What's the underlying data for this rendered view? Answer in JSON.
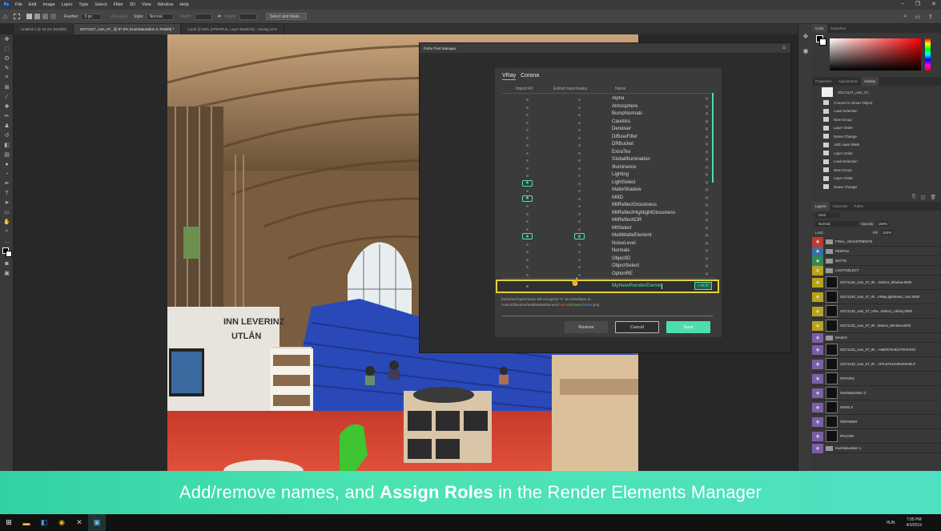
{
  "app": {
    "menu": [
      "File",
      "Edit",
      "Image",
      "Layer",
      "Type",
      "Select",
      "Filter",
      "3D",
      "View",
      "Window",
      "Help"
    ],
    "options": {
      "feather_label": "Feather:",
      "feather_value": "0 px",
      "anti_alias": "Anti-alias",
      "style_label": "Style:",
      "style_value": "Normal",
      "width_label": "Width:",
      "height_label": "Height:",
      "select_mask": "Select and Mask..."
    },
    "doc_tabs": [
      "Untitled-1 @ 34.2% (RGB/8)",
      "20171127_cam_07_ @ 57.5% (Hue/Saturation 3, RGB/8) *",
      "s.psb @ 50% (#PEOPLE, Layer Mask/16) - Saving 31%"
    ]
  },
  "panels": {
    "color_tabs": [
      "Color",
      "Swatches"
    ],
    "history_tabs": [
      "Properties",
      "Adjustments",
      "History"
    ],
    "history_doc": "20171127_cam_07_",
    "history_items": [
      "Convert to Smart Object",
      "Load Selection",
      "New Group",
      "Layer Order",
      "Name Change",
      "Add Layer Mask",
      "Layer Order",
      "Load Selection",
      "New Group",
      "Layer Order",
      "Name Change"
    ],
    "layers_tabs": [
      "Layers",
      "Channels",
      "Paths"
    ],
    "kind": "Kind",
    "blend_mode": "Normal",
    "opacity_label": "Opacity:",
    "opacity_value": "100%",
    "lock_label": "Lock:",
    "fill_label": "Fill:",
    "fill_value": "100%",
    "layers": [
      {
        "name": "FINAL_ADJUSTMENTS",
        "color": "#c0392b",
        "big": false
      },
      {
        "name": "PEOPLE",
        "color": "#3a6ea5",
        "big": false
      },
      {
        "name": "MATTE",
        "color": "#2e8b57",
        "big": false
      },
      {
        "name": "LIGHTSELECT",
        "color": "#b8a31a",
        "big": false
      },
      {
        "name": "20171130_cam_07_IR....tSelect_Window.0000",
        "color": "#b8a31a",
        "big": true
      },
      {
        "name": "20171130_cam_07_IR...VRayLightSelect_Sun.0000",
        "color": "#b8a31a",
        "big": true
      },
      {
        "name": "20171130_cam_07_VRa...tSelect_Library.0000",
        "color": "#b8a31a",
        "big": true
      },
      {
        "name": "20171130_cam_07_IR...tSelect_Window.0000",
        "color": "#b8a31a",
        "big": true
      },
      {
        "name": "MASKS",
        "color": "#7b5ea8",
        "big": false
      },
      {
        "name": "20171130_cam_07_IR....AMER#SHELF#STAIRS",
        "color": "#7b5ea8",
        "big": true
      },
      {
        "name": "20171130_cam_07_IR....OPLE#CHAIRS#SHELF",
        "color": "#7b5ea8",
        "big": true
      },
      {
        "name": "#STAIRS",
        "color": "#7b5ea8",
        "big": true
      },
      {
        "name": "Hue/Saturation 3",
        "color": "#7b5ea8",
        "big": true
      },
      {
        "name": "#SHELF",
        "color": "#7b5ea8",
        "big": true
      },
      {
        "name": "#DRAWER",
        "color": "#7b5ea8",
        "big": true
      },
      {
        "name": "#FLOOR",
        "color": "#7b5ea8",
        "big": true
      },
      {
        "name": "Hue/Saturation 1",
        "color": "#7b5ea8",
        "big": false
      }
    ]
  },
  "plugin": {
    "window_title": "Pulze Post Manager",
    "tabs": [
      "VRay",
      "Corona"
    ],
    "columns": {
      "import_all": "Import All",
      "extract": "Extract layermasks",
      "name": "Name"
    },
    "elements": [
      "Alpha",
      "Atmosphere",
      "BumpNormals",
      "Caustics",
      "Denoiser",
      "DiffuseFilter",
      "DRBucket",
      "ExtraTex",
      "GlobalIllumination",
      "Illuminance",
      "Lighting",
      "LightSelect",
      "MatteShadow",
      "MtlID",
      "MtlReflectGlossiness",
      "MtlReflectHighlightGlossiness",
      "MtlReflectIOR",
      "MtlSelect",
      "MultiMatteElement",
      "NoiseLevel",
      "Normals",
      "ObjectID",
      "ObjectSelect",
      "OptionRE"
    ],
    "import_stars": [
      "LightSelect",
      "MtlID",
      "MultiMatteElement"
    ],
    "extract_stars": [
      "MultiMatteElement"
    ],
    "new_name": "MyNewRenderEleme",
    "add_label": "+ ADD",
    "hint_line1": "Extracted layermasks will recognize \"#\" as namelayer ie.",
    "hint_prefix": "customfilename/MultiMatteElement",
    "hint_red": "#Name",
    "hint_green": "#Grass",
    "hint_blue": "#Stone",
    "hint_ext": ".png",
    "restore": "Restore",
    "cancel": "Cancel",
    "save": "Save",
    "accent": "#4fdcae",
    "highlight": "#e5d23a"
  },
  "scene_sign": {
    "line1": "INN LEVERINZ",
    "line2": "UTLÅN"
  },
  "banner": {
    "part1": "Add/remove names, and ",
    "bold": "Assign Roles",
    "part2": " in the Render Elements Manager"
  },
  "taskbar": {
    "lang": "HUN",
    "time": "7:05 PM",
    "date": "4/3/2019"
  }
}
